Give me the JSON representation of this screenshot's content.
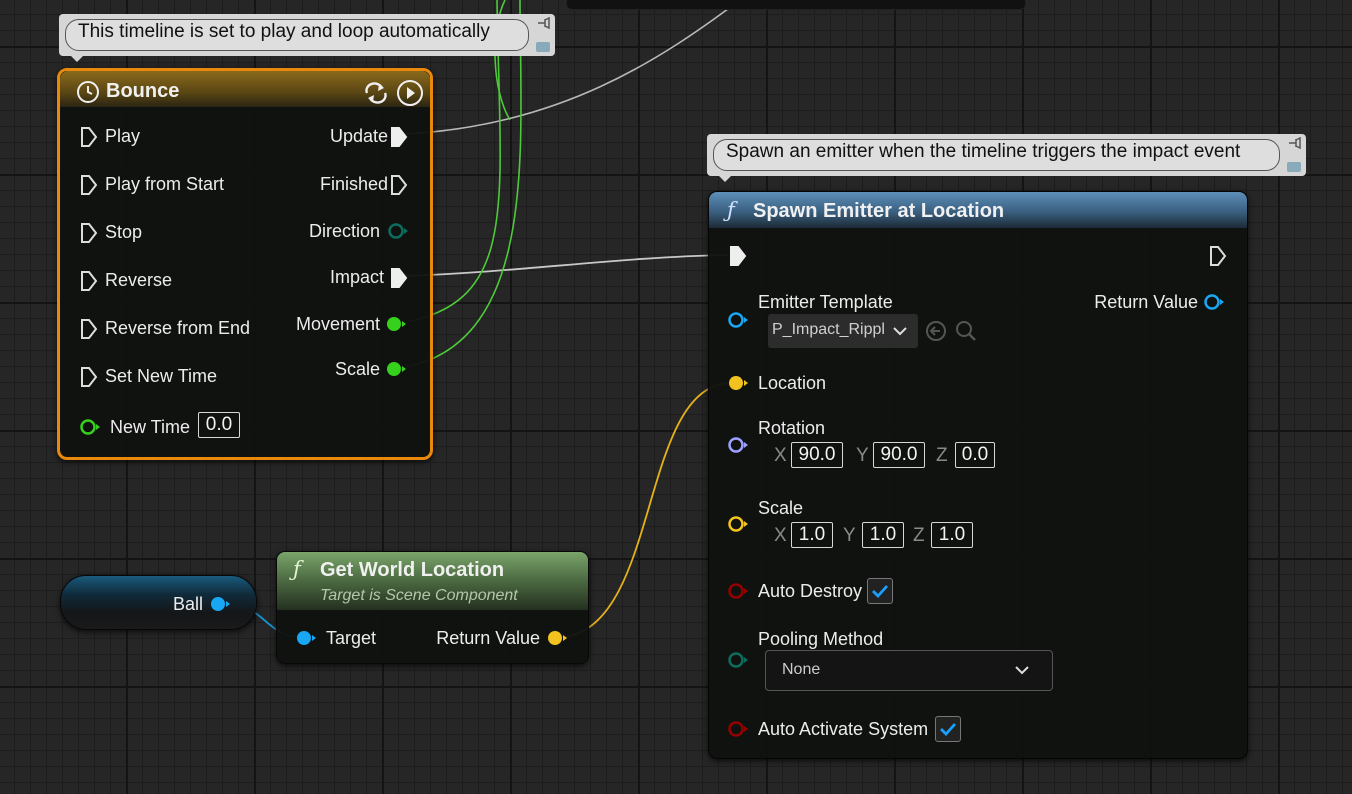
{
  "comments": {
    "timeline_comment": "This timeline is set to play and loop automatically",
    "spawn_comment": "Spawn an emitter when the timeline triggers the impact event"
  },
  "timeline_node": {
    "title": "Bounce",
    "inputs": [
      "Play",
      "Play from Start",
      "Stop",
      "Reverse",
      "Reverse from End",
      "Set New Time"
    ],
    "outputs": [
      "Update",
      "Finished",
      "Direction",
      "Impact",
      "Movement",
      "Scale"
    ],
    "new_time_label": "New Time",
    "new_time_value": "0.0"
  },
  "spawn_node": {
    "title": "Spawn Emitter at Location",
    "emitter_template_label": "Emitter Template",
    "emitter_template_value": "P_Impact_Ripple",
    "return_value_label": "Return Value",
    "location_label": "Location",
    "rotation_label": "Rotation",
    "rotation": {
      "x": "90.0",
      "y": "90.0",
      "z": "0.0"
    },
    "scale_label": "Scale",
    "scale": {
      "x": "1.0",
      "y": "1.0",
      "z": "1.0"
    },
    "axis_labels": {
      "x": "X",
      "y": "Y",
      "z": "Z"
    },
    "auto_destroy_label": "Auto Destroy",
    "auto_destroy": true,
    "pooling_method_label": "Pooling Method",
    "pooling_method_value": "None",
    "auto_activate_label": "Auto Activate System",
    "auto_activate": true
  },
  "get_world_location_node": {
    "title": "Get World Location",
    "subtitle": "Target is Scene Component",
    "target_label": "Target",
    "return_value_label": "Return Value"
  },
  "ball_var": {
    "label": "Ball"
  },
  "colors": {
    "exec": "#ffffff",
    "float": "#35d11c",
    "object": "#19a6f2",
    "vector": "#f2c21f",
    "rotator": "#9da0ff",
    "bool": "#950000",
    "enum": "#0b6d5e",
    "timeline_border": "#e8890c",
    "spawn_header": "#4f7ea5",
    "pure_header": "#5f7f4f"
  }
}
